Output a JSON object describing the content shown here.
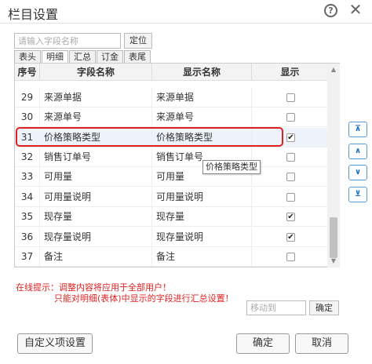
{
  "dialog": {
    "title": "栏目设置",
    "help_icon": "question-circle-icon",
    "close_icon": "close-icon"
  },
  "search": {
    "placeholder": "请输入字段名称",
    "locate_label": "定位"
  },
  "tabs": [
    {
      "label": "表头",
      "active": false
    },
    {
      "label": "明细",
      "active": true
    },
    {
      "label": "汇总",
      "active": false
    },
    {
      "label": "订金",
      "active": false
    },
    {
      "label": "表尾",
      "active": false
    }
  ],
  "table": {
    "headers": [
      "序号",
      "字段名称",
      "显示名称",
      "显示"
    ],
    "rows": [
      {
        "num": "29",
        "field": "来源单据",
        "display": "来源单据",
        "checked": false
      },
      {
        "num": "30",
        "field": "来源单号",
        "display": "来源单号",
        "checked": false
      },
      {
        "num": "31",
        "field": "价格策略类型",
        "display": "价格策略类型",
        "checked": true
      },
      {
        "num": "32",
        "field": "销售订单号",
        "display": "销售订单号",
        "checked": false
      },
      {
        "num": "33",
        "field": "可用量",
        "display": "可用量",
        "checked": false
      },
      {
        "num": "34",
        "field": "可用量说明",
        "display": "可用量说明",
        "checked": false
      },
      {
        "num": "35",
        "field": "现存量",
        "display": "现存量",
        "checked": true
      },
      {
        "num": "36",
        "field": "现存量说明",
        "display": "现存量说明",
        "checked": true
      },
      {
        "num": "37",
        "field": "备注",
        "display": "备注",
        "checked": false
      }
    ],
    "highlight_color": "#e02020"
  },
  "tooltip": "价格策略类型",
  "move_buttons": {
    "top": "⊼",
    "up": "∧",
    "down": "∨",
    "bottom": "⊻"
  },
  "hints": {
    "line1": "在线提示：调整内容将应用于全部用户！",
    "line2": "只能对明细(表体)中显示的字段进行汇总设置！"
  },
  "moveto": {
    "placeholder": "移动到",
    "confirm_label": "确定"
  },
  "footer": {
    "custom_label": "自定义项设置",
    "ok_label": "确定",
    "cancel_label": "取消"
  }
}
